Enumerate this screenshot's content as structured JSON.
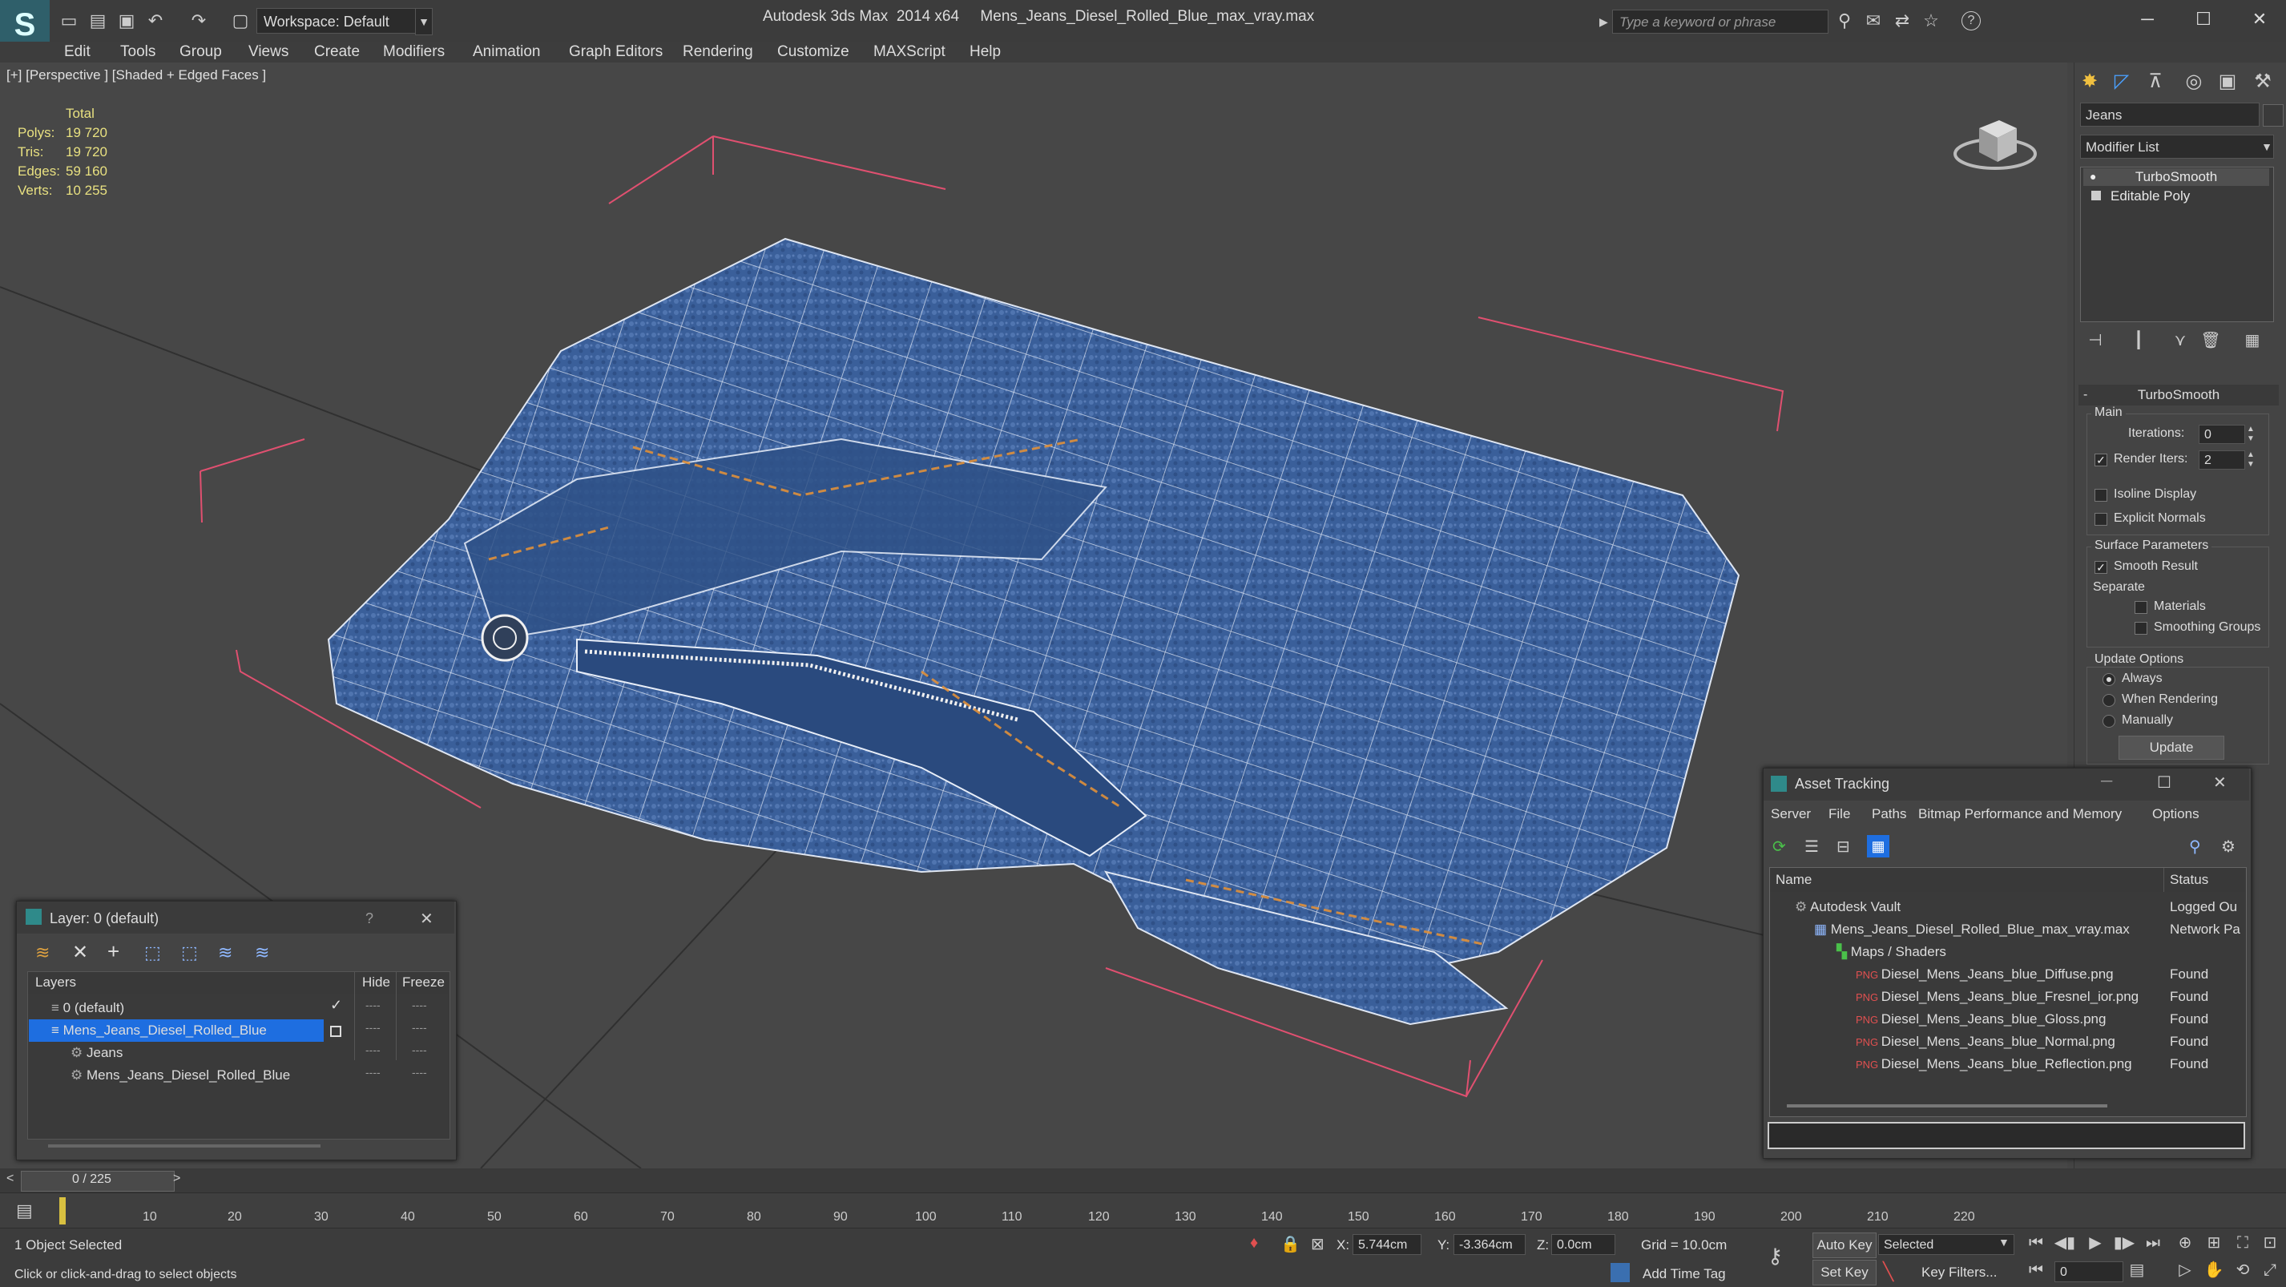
{
  "app": {
    "title": "Autodesk 3ds Max  2014 x64     Mens_Jeans_Diesel_Rolled_Blue_max_vray.max",
    "logo_glyph": "S",
    "workspace_label": "Workspace: Default",
    "search_placeholder": "Type a keyword or phrase",
    "help_glyph": "?",
    "minimize_glyph": "─",
    "maximize_glyph": "☐",
    "close_glyph": "✕"
  },
  "menu": [
    "Edit",
    "Tools",
    "Group",
    "Views",
    "Create",
    "Modifiers",
    "Animation",
    "Graph Editors",
    "Rendering",
    "Customize",
    "MAXScript",
    "Help"
  ],
  "viewport": {
    "label": "[+] [Perspective ] [Shaded + Edged Faces ]",
    "stats": {
      "header": "Total",
      "rows": [
        {
          "label": "Polys:",
          "value": "19 720"
        },
        {
          "label": "Tris:",
          "value": "19 720"
        },
        {
          "label": "Edges:",
          "value": "59 160"
        },
        {
          "label": "Verts:",
          "value": "10 255"
        }
      ]
    }
  },
  "command_panel": {
    "object_name": "Jeans",
    "modifier_list": "Modifier List",
    "stack": [
      "TurboSmooth",
      "Editable Poly"
    ],
    "rollout_title": "TurboSmooth",
    "main_group": "Main",
    "iterations_label": "Iterations:",
    "iterations_value": "0",
    "render_iters_label": "Render Iters:",
    "render_iters_value": "2",
    "render_iters_checked": true,
    "isoline_label": "Isoline Display",
    "explicit_normals_label": "Explicit Normals",
    "surface_group": "Surface Parameters",
    "smooth_result_label": "Smooth Result",
    "separate_label": "Separate",
    "materials_label": "Materials",
    "smoothing_groups_label": "Smoothing Groups",
    "update_group": "Update Options",
    "always_label": "Always",
    "when_rendering_label": "When Rendering",
    "manually_label": "Manually",
    "update_button": "Update"
  },
  "layer_window": {
    "title": "Layer: 0 (default)",
    "help": "?",
    "close": "✕",
    "col_layers": "Layers",
    "col_hide": "Hide",
    "col_freeze": "Freeze",
    "rows": [
      {
        "name": "0 (default)",
        "selected": false,
        "current": true
      },
      {
        "name": "Mens_Jeans_Diesel_Rolled_Blue",
        "selected": true,
        "current": false
      },
      {
        "name": "Jeans",
        "selected": false,
        "current": false
      },
      {
        "name": "Mens_Jeans_Diesel_Rolled_Blue",
        "selected": false,
        "current": false
      }
    ],
    "dash": "----",
    "check": "✓"
  },
  "asset_window": {
    "title": "Asset Tracking",
    "menus": [
      "Server",
      "File",
      "Paths",
      "Bitmap Performance and Memory",
      "Options"
    ],
    "col_name": "Name",
    "col_status": "Status",
    "rows": [
      {
        "name": "Autodesk Vault",
        "status": "Logged Ou"
      },
      {
        "name": "Mens_Jeans_Diesel_Rolled_Blue_max_vray.max",
        "status": "Network Pa"
      },
      {
        "name": "Maps / Shaders",
        "status": ""
      },
      {
        "name": "Diesel_Mens_Jeans_blue_Diffuse.png",
        "status": "Found"
      },
      {
        "name": "Diesel_Mens_Jeans_blue_Fresnel_ior.png",
        "status": "Found"
      },
      {
        "name": "Diesel_Mens_Jeans_blue_Gloss.png",
        "status": "Found"
      },
      {
        "name": "Diesel_Mens_Jeans_blue_Normal.png",
        "status": "Found"
      },
      {
        "name": "Diesel_Mens_Jeans_blue_Reflection.png",
        "status": "Found"
      }
    ]
  },
  "timeline": {
    "frame_label": "0 / 225",
    "ticks": [
      "10",
      "20",
      "30",
      "40",
      "50",
      "60",
      "70",
      "80",
      "90",
      "100",
      "110",
      "120",
      "130",
      "140",
      "150",
      "160",
      "170",
      "180",
      "190",
      "200",
      "210",
      "220"
    ]
  },
  "status": {
    "selection": "1 Object Selected",
    "prompt": "Click or click-and-drag to select objects",
    "x_label": "X:",
    "x_value": "5.744cm",
    "y_label": "Y:",
    "y_value": "-3.364cm",
    "z_label": "Z:",
    "z_value": "0.0cm",
    "grid": "Grid = 10.0cm",
    "add_time_tag": "Add Time Tag",
    "auto_key": "Auto Key",
    "set_key": "Set Key",
    "selected_value": "Selected",
    "key_filters": "Key Filters...",
    "frame_value": "0"
  },
  "colors": {
    "denim": "#3a5f9a",
    "selection": "#1e6ee0",
    "stats": "#e8e080"
  }
}
